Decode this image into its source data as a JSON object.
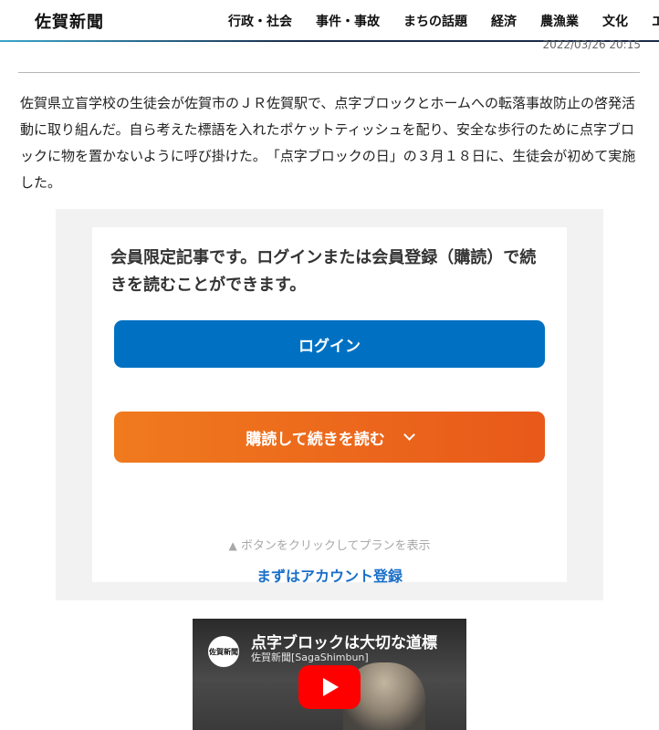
{
  "header": {
    "logo": "佐賀新聞",
    "nav": [
      "行政・社会",
      "事件・事故",
      "まちの話題",
      "経済",
      "農漁業",
      "文化",
      "エ"
    ]
  },
  "article": {
    "timestamp": "2022/03/26 20:15",
    "body": "佐賀県立盲学校の生徒会が佐賀市のＪＲ佐賀駅で、点字ブロックとホームへの転落事故防止の啓発活動に取り組んだ。自ら考えた標語を入れたポケットティッシュを配り、安全な歩行のために点字ブロックに物を置かないように呼び掛けた。　「点字ブロックの日」の３月１８日に、生徒会が初めて実施した。"
  },
  "paywall": {
    "message": "会員限定記事です。ログインまたは会員登録（購読）で続きを読むことができます。",
    "login_label": "ログイン",
    "subscribe_label": "購読して続きを読む",
    "hint_icon": "▲",
    "hint": "ボタンをクリックしてプランを表示",
    "account_link": "まずはアカウント登録"
  },
  "video": {
    "avatar_text": "佐賀新聞",
    "title": "点字ブロックは大切な道標",
    "channel": "佐賀新聞[SagaShimbun]"
  },
  "colors": {
    "login_blue": "#0071c2",
    "subscribe_orange": "#f07a1e",
    "link_blue": "#1a6fc9",
    "youtube_red": "#ff0000"
  }
}
